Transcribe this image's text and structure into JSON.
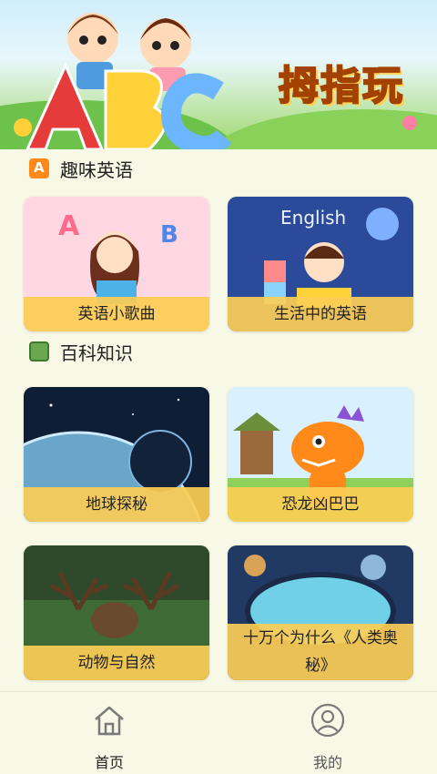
{
  "banner": {
    "title": "拇指玩",
    "letters": "ABC"
  },
  "sections": [
    {
      "title": "趣味英语",
      "icon": "english-letter-icon"
    },
    {
      "title": "百科知识",
      "icon": "book-icon"
    }
  ],
  "cards": [
    {
      "label": "英语小歌曲"
    },
    {
      "label": "生活中的英语",
      "image_text": "English"
    },
    {
      "label": "地球探秘"
    },
    {
      "label": "恐龙凶巴巴"
    },
    {
      "label": "动物与自然"
    },
    {
      "label": "十万个为什么《人类奥秘》"
    }
  ],
  "nav": [
    {
      "label": "首页",
      "icon": "home-icon",
      "active": true
    },
    {
      "label": "我的",
      "icon": "user-icon",
      "active": false
    }
  ],
  "colors": {
    "accent": "#fccd55",
    "background": "#f7f9e6",
    "title_orange": "#ff8a1a"
  }
}
